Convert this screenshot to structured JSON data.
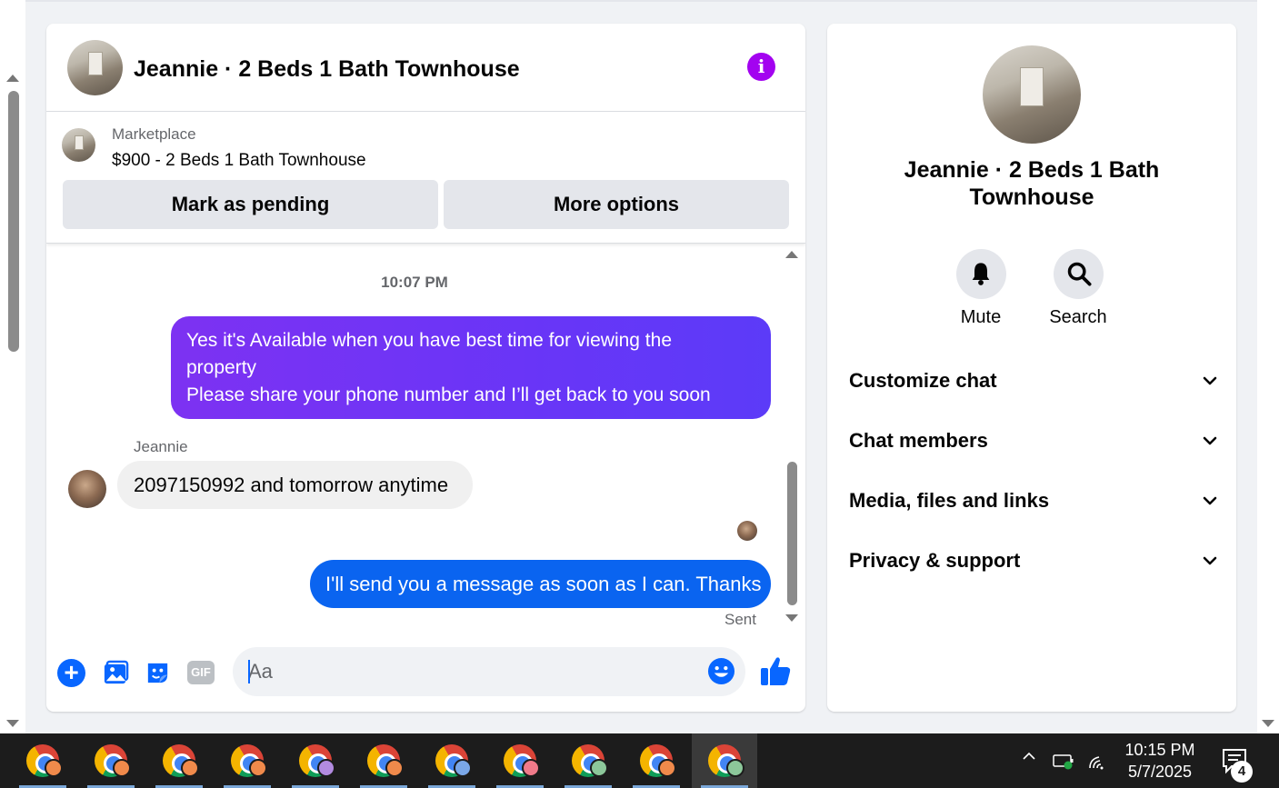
{
  "chat": {
    "title": "Jeannie · 2 Beds 1 Bath Townhouse",
    "info_icon": "info-icon",
    "marketplace": {
      "label": "Marketplace",
      "item": "$900 - 2 Beds 1 Bath Townhouse",
      "mark_pending": "Mark as pending",
      "more_options": "More options"
    },
    "timestamp": "10:07 PM",
    "messages": [
      {
        "direction": "outgoing",
        "lines": [
          "Yes it's Available when you have best time for viewing the",
          "property",
          "Please share your phone number and I’ll get back to you soon"
        ],
        "color": "#7a34f3"
      },
      {
        "direction": "incoming",
        "sender": "Jeannie",
        "text": "2097150992 and tomorrow anytime"
      },
      {
        "direction": "outgoing",
        "text": "I'll send you a message as soon as I can. Thanks",
        "status": "Sent",
        "color": "#0a64f0"
      }
    ],
    "composer": {
      "placeholder": "Aa",
      "value": "",
      "icons": [
        "plus-circle-icon",
        "photo-icon",
        "sticker-icon",
        "gif-icon",
        "emoji-icon",
        "thumbs-up-icon"
      ],
      "gif_label": "GIF"
    }
  },
  "info_panel": {
    "title": "Jeannie · 2 Beds 1 Bath Townhouse",
    "actions": [
      {
        "label": "Mute",
        "icon": "bell-icon"
      },
      {
        "label": "Search",
        "icon": "search-icon"
      }
    ],
    "sections": [
      "Customize chat",
      "Chat members",
      "Media, files and links",
      "Privacy & support"
    ]
  },
  "taskbar": {
    "apps": [
      {
        "icon": "chrome-icon",
        "profile_color": "#f08a4b"
      },
      {
        "icon": "chrome-icon",
        "profile_color": "#f08a4b"
      },
      {
        "icon": "chrome-icon",
        "profile_color": "#f08a4b"
      },
      {
        "icon": "chrome-icon",
        "profile_color": "#f08a4b"
      },
      {
        "icon": "chrome-icon",
        "profile_color": "#b28be0"
      },
      {
        "icon": "chrome-icon",
        "profile_color": "#f08a4b"
      },
      {
        "icon": "chrome-icon",
        "profile_color": "#7aa7e8"
      },
      {
        "icon": "chrome-icon",
        "profile_color": "#f07a8a"
      },
      {
        "icon": "chrome-icon",
        "profile_color": "#8cc79a"
      },
      {
        "icon": "chrome-icon",
        "profile_color": "#f08a4b"
      },
      {
        "icon": "chrome-icon",
        "profile_color": "#8cc79a",
        "active": true
      }
    ],
    "time": "10:15 PM",
    "date": "5/7/2025",
    "notification_count": "4"
  },
  "colors": {
    "accent_blue": "#0866ff",
    "info_purple": "#a303f0",
    "panel_bg": "#f0f2f5"
  }
}
